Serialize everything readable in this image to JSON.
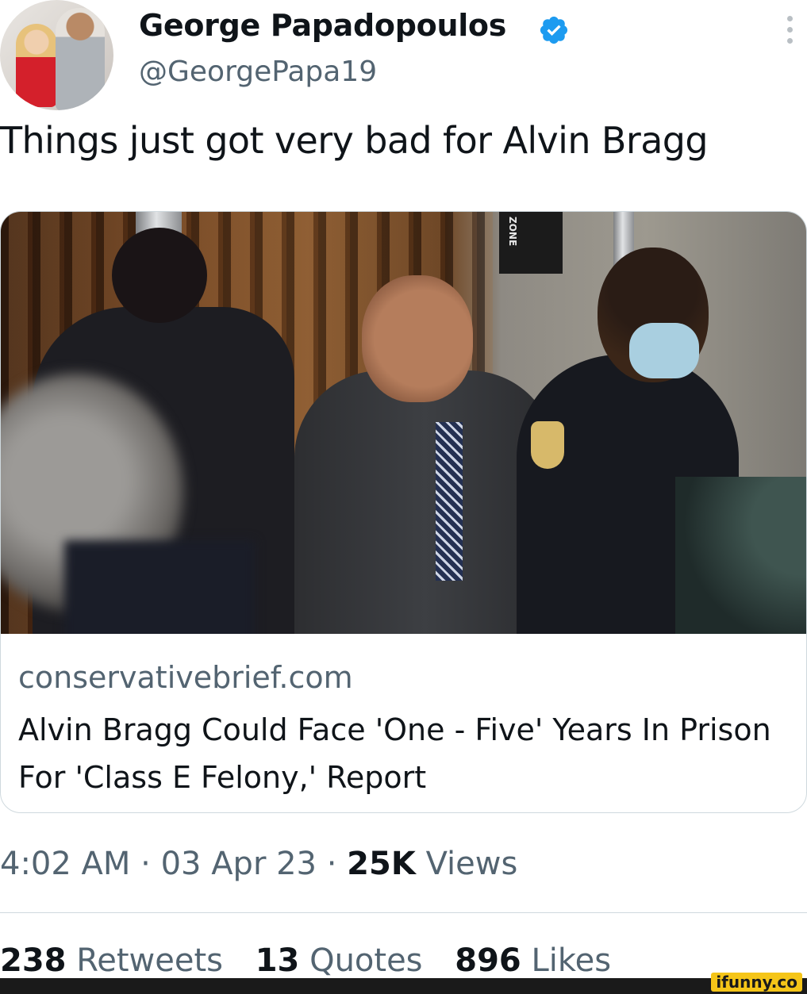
{
  "author": {
    "display_name": "George Papadopoulos",
    "handle": "@GeorgePapa19",
    "verified": true,
    "verified_color": "#1d9bf0",
    "avatar_icon": "profile-photo"
  },
  "more_icon": "more-vertical-icon",
  "tweet": {
    "text": "Things just got very bad for Alvin Bragg"
  },
  "card": {
    "photo_sign_text": "ZONE",
    "domain": "conservativebrief.com",
    "title": "Alvin Bragg Could Face 'One - Five' Years In Prison For 'Class E Felony,' Report"
  },
  "meta": {
    "time": "4:02 AM",
    "separator": "·",
    "date": "03 Apr 23",
    "views_count": "25K",
    "views_label": "Views"
  },
  "stats": {
    "retweets_count": "238",
    "retweets_label": "Retweets",
    "quotes_count": "13",
    "quotes_label": "Quotes",
    "likes_count": "896",
    "likes_label": "Likes"
  },
  "watermark": "ifunny.co",
  "colors": {
    "text_primary": "#0f1419",
    "text_secondary": "#536471",
    "border": "#cfd9de",
    "watermark_bg": "#f5c518"
  }
}
